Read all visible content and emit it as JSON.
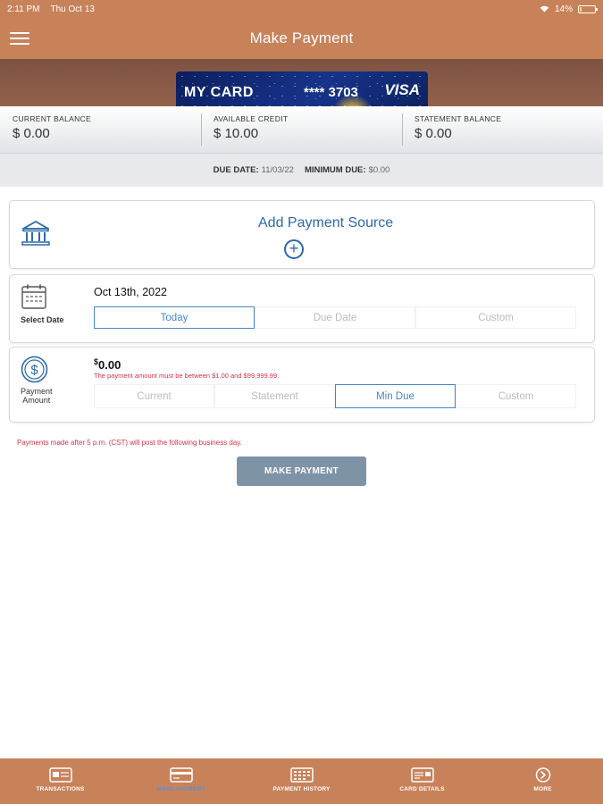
{
  "status_bar": {
    "time": "2:11 PM",
    "date": "Thu Oct 13",
    "battery": "14%",
    "battery_level": 0.14
  },
  "header": {
    "title": "Make Payment"
  },
  "card": {
    "name": "MY CARD",
    "number": "**** 3703",
    "brand": "VISA"
  },
  "balances": [
    {
      "label": "CURRENT BALANCE",
      "value": "$ 0.00"
    },
    {
      "label": "AVAILABLE CREDIT",
      "value": "$ 10.00"
    },
    {
      "label": "STATEMENT BALANCE",
      "value": "$ 0.00"
    }
  ],
  "due": {
    "due_label": "DUE DATE:",
    "due_value": "11/03/22",
    "min_label": "MINIMUM DUE:",
    "min_value": "$0.00"
  },
  "payment_source": {
    "title": "Add Payment Source",
    "add_symbol": "+"
  },
  "select_date": {
    "label": "Select Date",
    "value": "Oct 13th, 2022",
    "options": [
      "Today",
      "Due Date",
      "Custom"
    ],
    "selected": "Today"
  },
  "payment_amount": {
    "label_line1": "Payment",
    "label_line2": "Amount",
    "currency_symbol": "$",
    "value": "0.00",
    "note": "The payment amount must be between $1.00 and $99,999.99.",
    "options": [
      "Current",
      "Statement",
      "Min Due",
      "Custom"
    ],
    "selected": "Min Due"
  },
  "notice": "Payments made after 5 p.m. (CST) will post the following business day.",
  "make_payment_button": "MAKE PAYMENT",
  "bottom_nav": [
    {
      "label": "TRANSACTIONS",
      "icon": "transactions-icon"
    },
    {
      "label": "MAKE PAYMENT",
      "icon": "make-payment-icon",
      "active": true
    },
    {
      "label": "PAYMENT HISTORY",
      "icon": "payment-history-icon"
    },
    {
      "label": "CARD DETAILS",
      "icon": "card-details-icon"
    },
    {
      "label": "MORE",
      "icon": "more-icon"
    }
  ],
  "colors": {
    "brand": "#c8825a",
    "link": "#2e6aa8",
    "error": "#d0344a",
    "button": "#7f93a6",
    "active_nav": "#5b8fd6"
  }
}
